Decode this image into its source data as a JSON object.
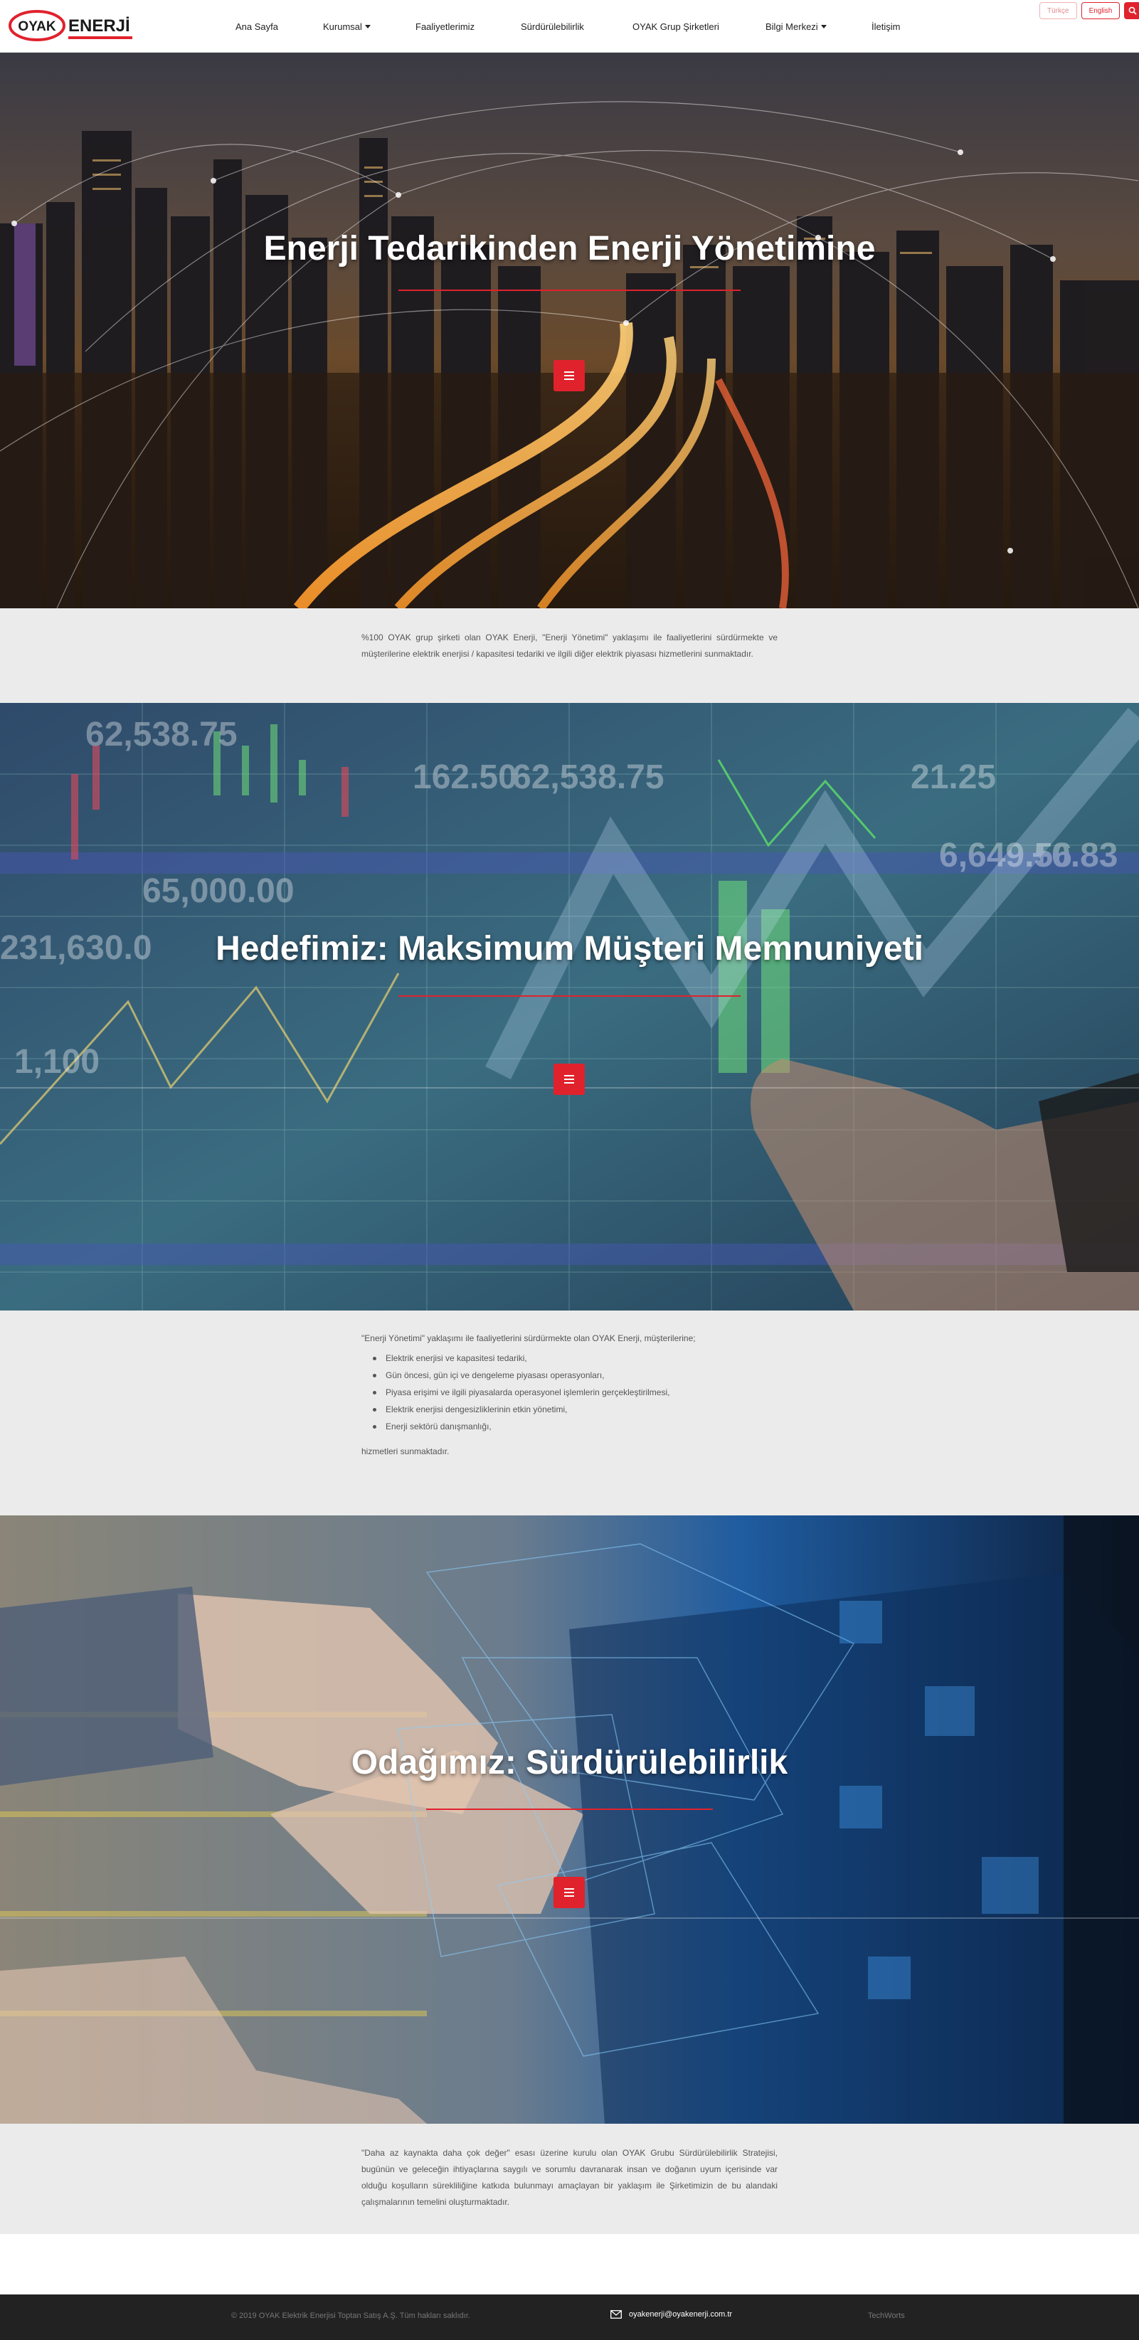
{
  "brand": {
    "logo_oyak": "OYAK",
    "logo_enerji": "ENERJİ",
    "accent_color": "#e0222d"
  },
  "nav": {
    "items": [
      {
        "label": "Ana Sayfa",
        "dropdown": false
      },
      {
        "label": "Kurumsal",
        "dropdown": true
      },
      {
        "label": "Faaliyetlerimiz",
        "dropdown": false
      },
      {
        "label": "Sürdürülebilirlik",
        "dropdown": false
      },
      {
        "label": "OYAK Grup Şirketleri",
        "dropdown": false
      },
      {
        "label": "Bilgi Merkezi",
        "dropdown": true
      },
      {
        "label": "İletişim",
        "dropdown": false
      }
    ],
    "lang_tr": "Türkçe",
    "lang_en": "English",
    "search_icon": "search-icon"
  },
  "hero1": {
    "title": "Enerji Tedarikinden Enerji Yönetimine",
    "menu_icon": "menu-icon"
  },
  "intro": {
    "text": "%100 OYAK grup şirketi olan OYAK Enerji, \"Enerji Yönetimi\" yaklaşımı ile faaliyetlerini sürdürmekte ve müşterilerine elektrik enerjisi / kapasitesi tedariki ve ilgili diğer elektrik piyasası hizmetlerini sunmaktadır."
  },
  "hero2": {
    "title": "Hedefimiz: Maksimum Müşteri Memnuniyeti",
    "menu_icon": "menu-icon"
  },
  "services": {
    "intro": "\"Enerji Yönetimi\" yaklaşımı ile faaliyetlerini sürdürmekte olan OYAK Enerji, müşterilerine;",
    "items": [
      "Elektrik enerjisi ve kapasitesi tedariki,",
      "Gün öncesi, gün içi ve dengeleme piyasası operasyonları,",
      "Piyasa erişimi ve ilgili piyasalarda operasyonel işlemlerin gerçekleştirilmesi,",
      "Elektrik enerjisi dengesizliklerinin etkin yönetimi,",
      "Enerji sektörü danışmanlığı,"
    ],
    "outro": "hizmetleri sunmaktadır."
  },
  "hero3": {
    "title": "Odağımız: Sürdürülebilirlik",
    "menu_icon": "menu-icon"
  },
  "sustain": {
    "text": "\"Daha az kaynakta daha çok değer\" esası üzerine kurulu olan OYAK Grubu Sürdürülebilirlik Stratejisi, bugünün ve geleceğin ihtiyaçlarına saygılı ve sorumlu davranarak insan ve doğanın uyum içerisinde var olduğu koşulların sürekliliğine katkıda bulunmayı amaçlayan bir yaklaşım ile Şirketimizin de bu alandaki çalışmalarının temelini oluşturmaktadır."
  },
  "footer": {
    "copyright": "© 2019 OYAK Elektrik Enerjisi Toptan Satış A.Ş. Tüm hakları saklıdır.",
    "email": "oyakenerji@oyakenerji.com.tr",
    "credit": "TechWorts",
    "mail_icon": "mail-icon"
  }
}
